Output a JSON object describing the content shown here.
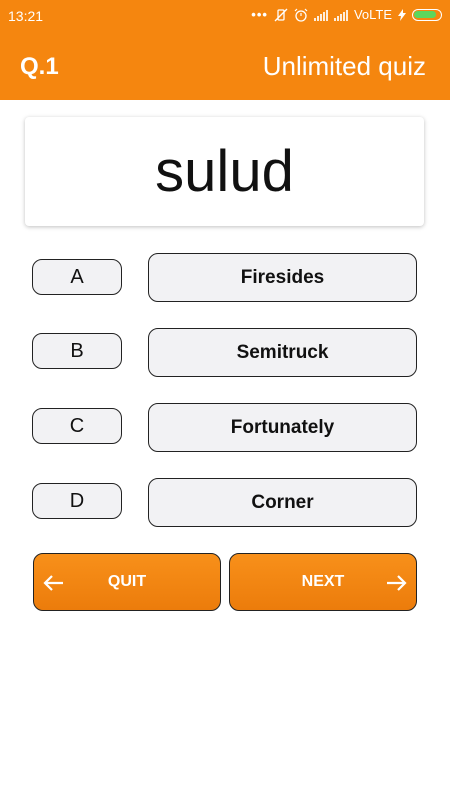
{
  "status_bar": {
    "time": "13:21",
    "network_label": "VoLTE",
    "icons": [
      "more-dots-icon",
      "vibrate-off-icon",
      "alarm-icon",
      "signal-icon",
      "signal-icon",
      "charging-icon",
      "battery-icon"
    ]
  },
  "app_bar": {
    "question_number": "Q.1",
    "title": "Unlimited quiz",
    "color": "#f5860f"
  },
  "quiz": {
    "word": "sulud",
    "options": [
      {
        "letter": "A",
        "answer": "Firesides"
      },
      {
        "letter": "B",
        "answer": "Semitruck"
      },
      {
        "letter": "C",
        "answer": "Fortunately"
      },
      {
        "letter": "D",
        "answer": "Corner"
      }
    ]
  },
  "actions": {
    "quit_label": "QUIT",
    "next_label": "NEXT"
  }
}
